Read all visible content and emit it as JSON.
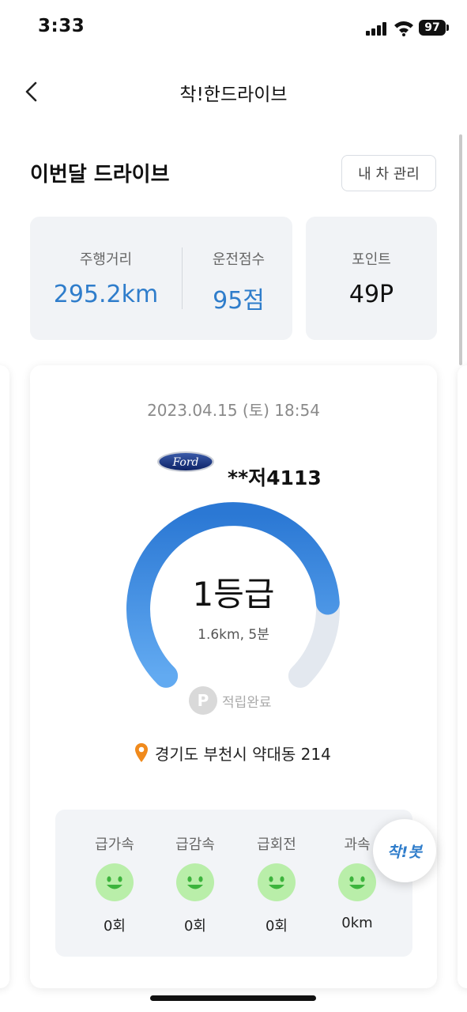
{
  "status_bar": {
    "time": "3:33",
    "battery": "97"
  },
  "nav": {
    "title": "착!한드라이브"
  },
  "summary": {
    "title": "이번달 드라이브",
    "manage_button": "내 차 관리",
    "distance_label": "주행거리",
    "distance_value": "295.2km",
    "score_label": "운전점수",
    "score_value": "95점",
    "points_label": "포인트",
    "points_value": "49P"
  },
  "drive": {
    "datetime": "2023.04.15 (토) 18:54",
    "brand_icon": "ford-logo",
    "plate": "**저4113",
    "grade": "1등급",
    "detail": "1.6km, 5분",
    "point_badge": "P",
    "point_status": "적립완료",
    "address": "경기도 부천시 약대동 214",
    "gauge_fraction": 0.82
  },
  "events": [
    {
      "label": "급가속",
      "value": "0회",
      "icon": "smiley-icon"
    },
    {
      "label": "급감속",
      "value": "0회",
      "icon": "smiley-icon"
    },
    {
      "label": "급회전",
      "value": "0회",
      "icon": "smiley-icon"
    },
    {
      "label": "과속",
      "value": "0km",
      "icon": "smiley-icon"
    }
  ],
  "fab": {
    "label": "착!봇"
  },
  "colors": {
    "accent": "#2f7dcb",
    "smiley_bg": "#b9eea9",
    "smiley_face": "#3cb43c"
  }
}
